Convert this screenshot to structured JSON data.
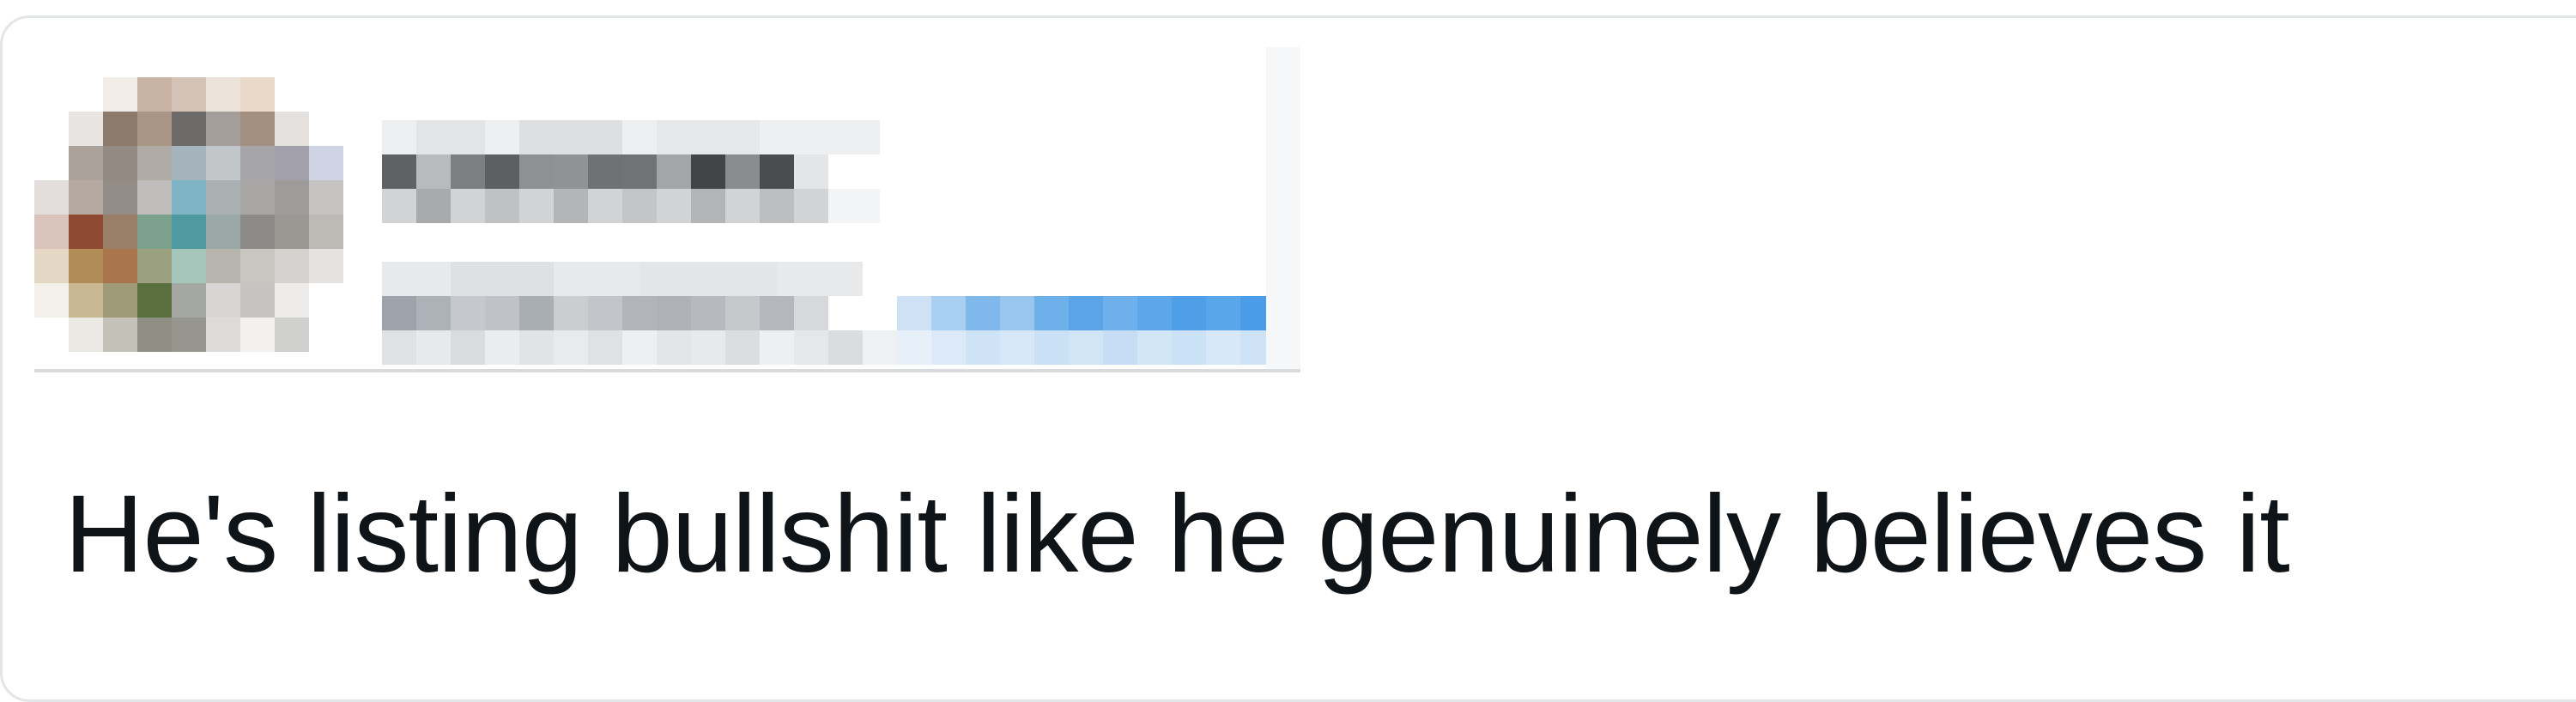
{
  "tweet": {
    "text": "He's listing bullshit like he genuinely believes it"
  },
  "author": {
    "display_name": "",
    "handle": ""
  },
  "colors": {
    "text": "#0f1419",
    "border": "#e3e6e8",
    "link_blue": "#1d9bf0"
  }
}
